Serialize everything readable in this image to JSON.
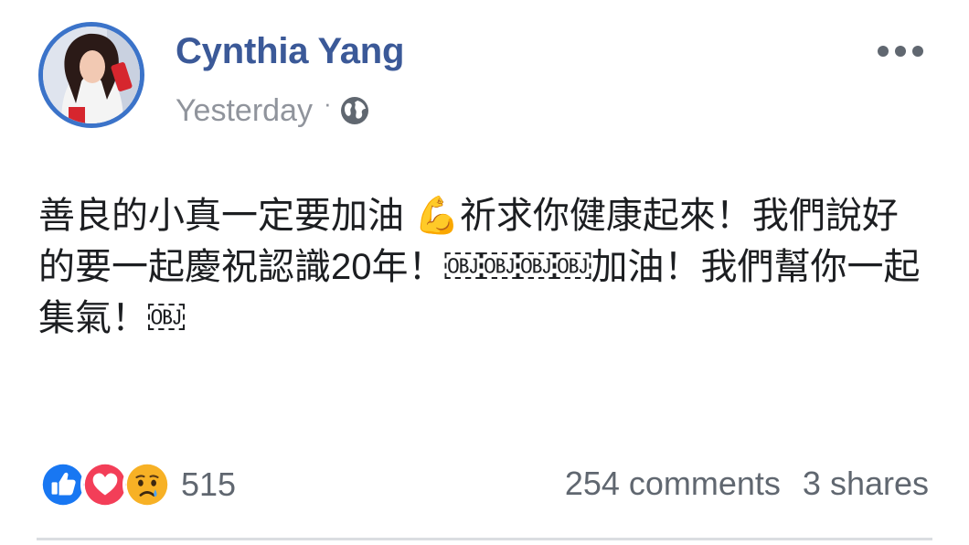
{
  "post": {
    "author": "Cynthia Yang",
    "timestamp": "Yesterday",
    "visibility_icon": "globe-icon",
    "body": "善良的小真一定要加油 💪祈求你健康起來！我們說好的要一起慶祝認識20年！￼￼￼￼加油！我們幫你一起集氣！￼"
  },
  "reactions": {
    "types": [
      "like-reaction-icon",
      "love-reaction-icon",
      "sad-reaction-icon"
    ],
    "count": "515"
  },
  "stats": {
    "comments": "254 comments",
    "shares": "3 shares"
  },
  "colors": {
    "author": "#3b5998",
    "avatar_ring": "#3b73c9",
    "muted": "#90949c",
    "like": "#1877f2",
    "love": "#f33e58",
    "sad": "#f7b125"
  }
}
